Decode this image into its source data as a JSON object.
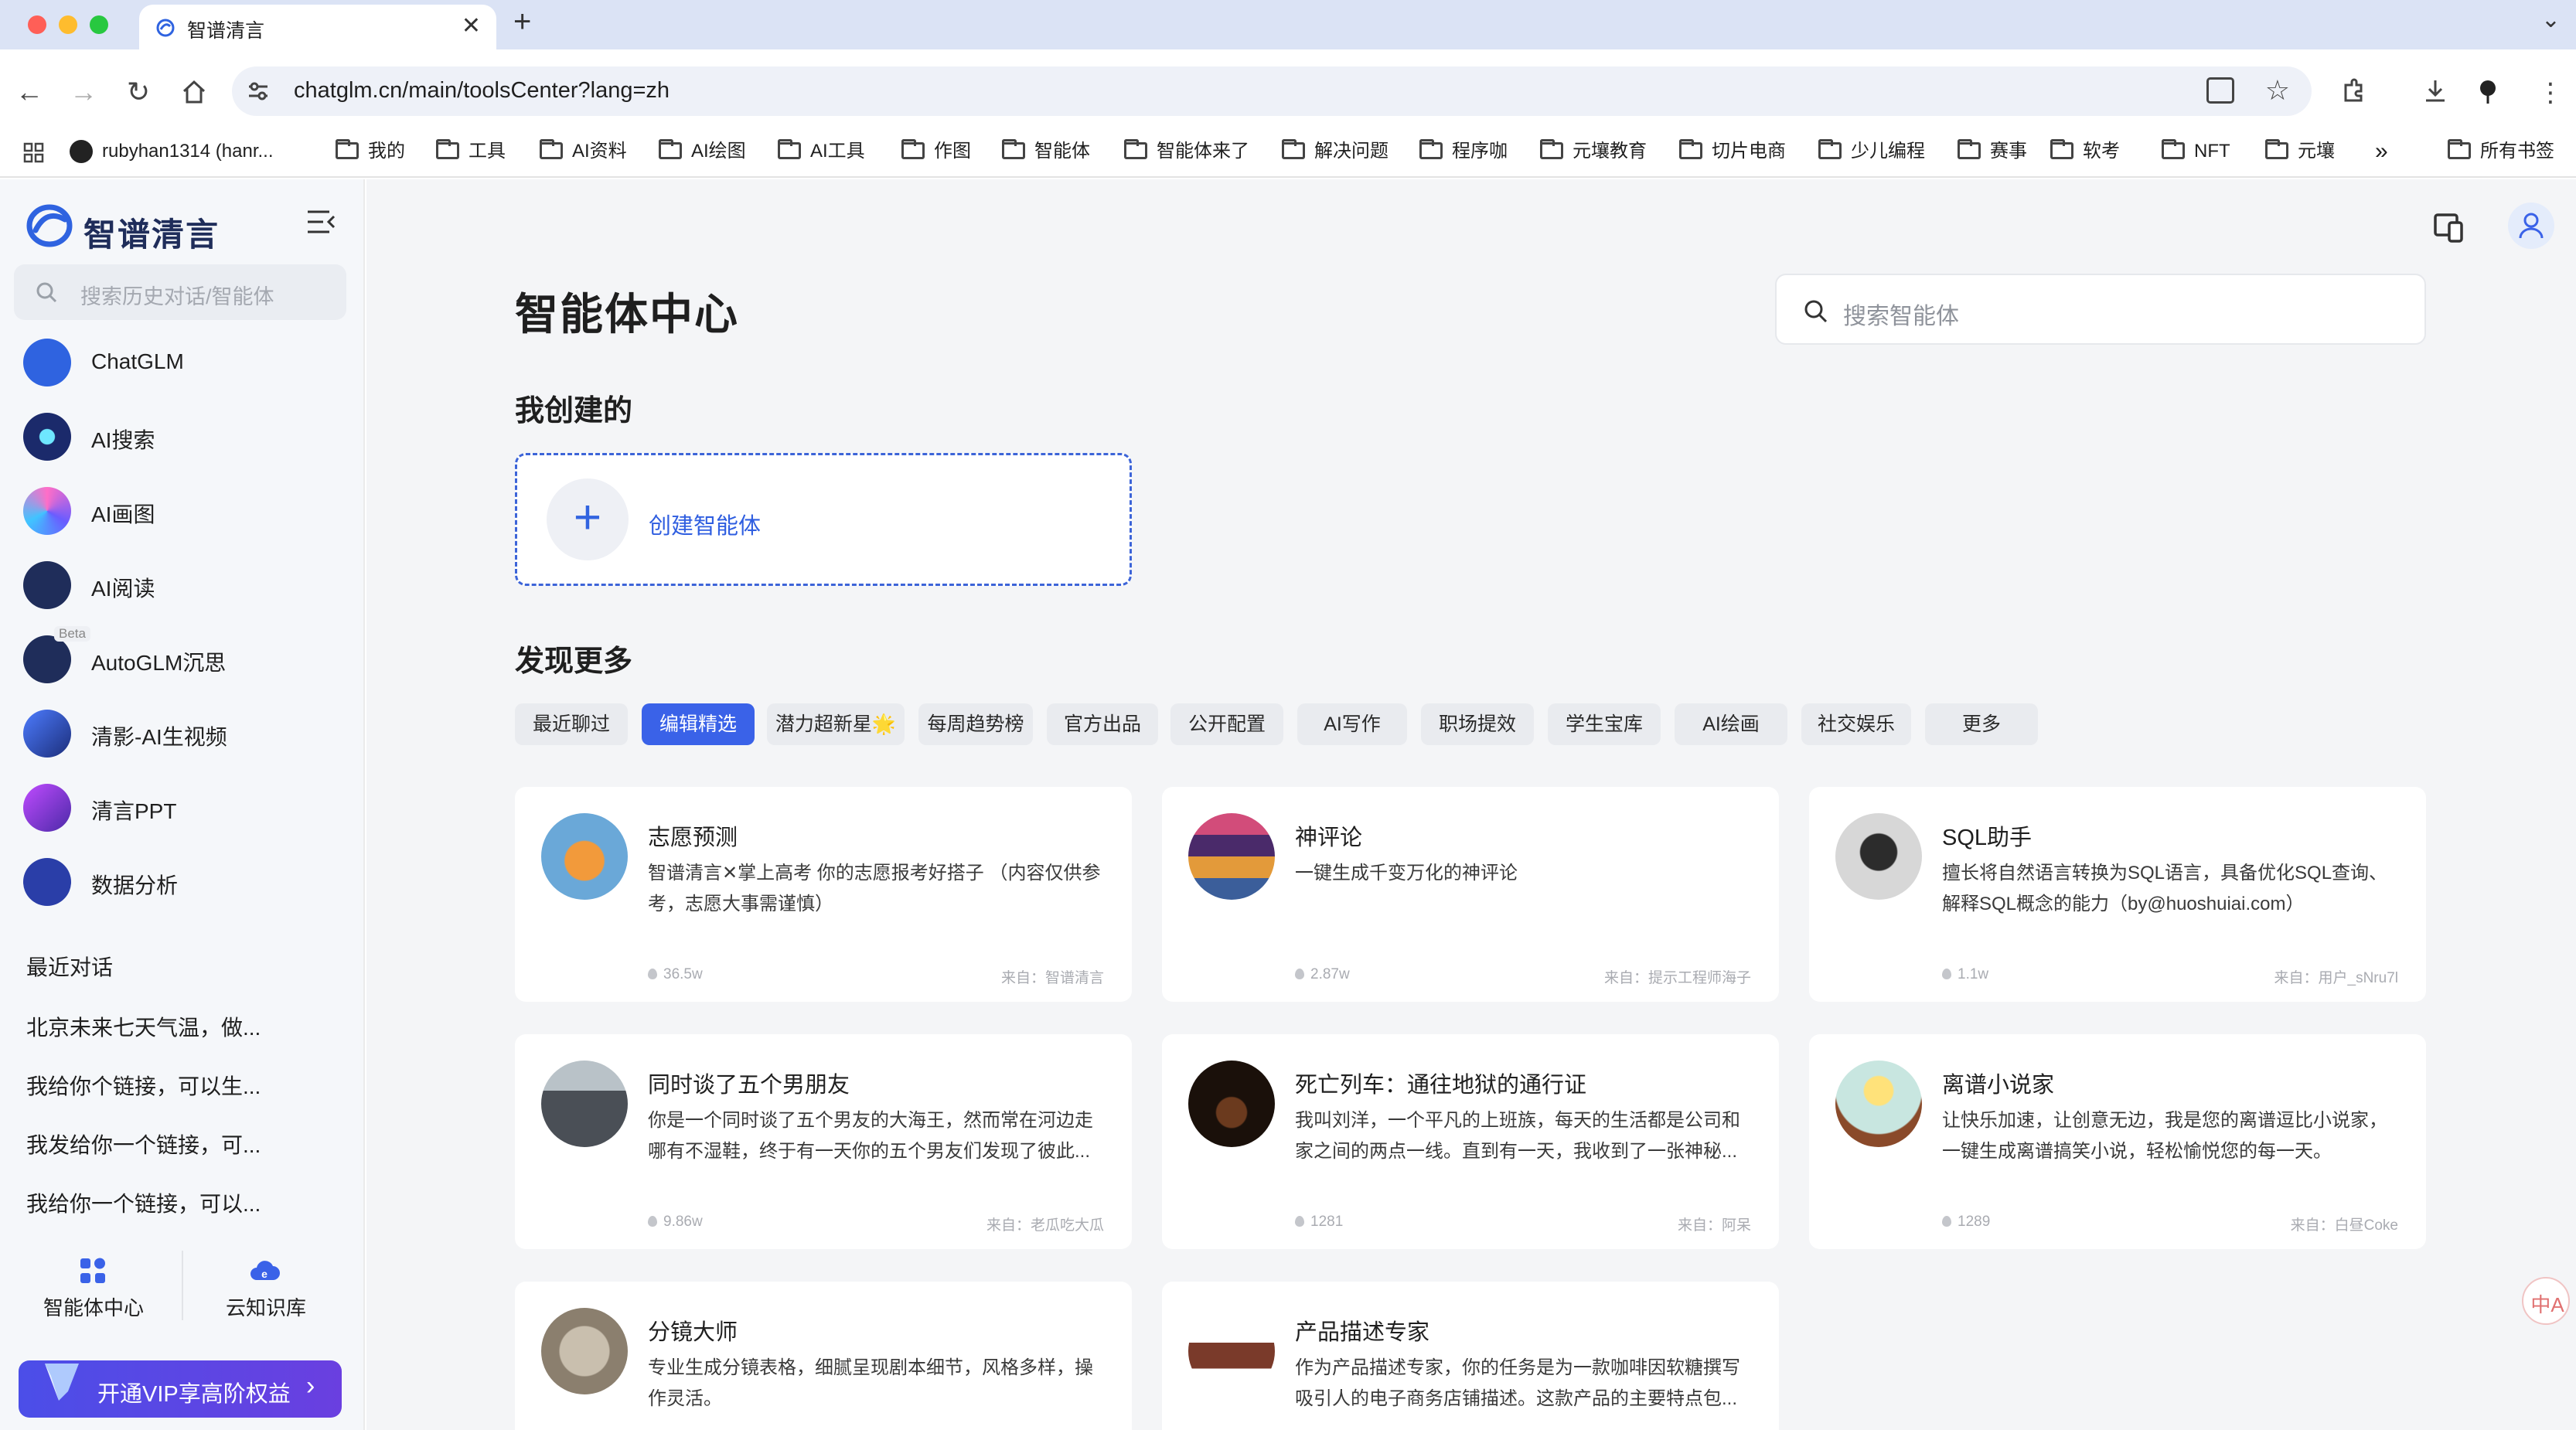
{
  "browser": {
    "tab_title": "智谱清言",
    "url": "chatglm.cn/main/toolsCenter?lang=zh",
    "bookmarks": [
      {
        "label": "rubyhan1314 (hanr..."
      },
      {
        "label": "我的"
      },
      {
        "label": "工具"
      },
      {
        "label": "AI资料"
      },
      {
        "label": "AI绘图"
      },
      {
        "label": "AI工具"
      },
      {
        "label": "作图"
      },
      {
        "label": "智能体"
      },
      {
        "label": "智能体来了"
      },
      {
        "label": "解决问题"
      },
      {
        "label": "程序咖"
      },
      {
        "label": "元壤教育"
      },
      {
        "label": "切片电商"
      },
      {
        "label": "少儿编程"
      },
      {
        "label": "赛事"
      },
      {
        "label": "软考"
      },
      {
        "label": "NFT"
      },
      {
        "label": "元壤"
      }
    ],
    "more_bookmarks": "»",
    "all_bookmarks": "所有书签"
  },
  "sidebar": {
    "logo_text": "智谱清言",
    "search_placeholder": "搜索历史对话/智能体",
    "nav": [
      {
        "label": "ChatGLM",
        "icon": "chatglm-icon"
      },
      {
        "label": "AI搜索",
        "icon": "ai-search-icon"
      },
      {
        "label": "AI画图",
        "icon": "ai-draw-icon"
      },
      {
        "label": "AI阅读",
        "icon": "ai-read-icon"
      },
      {
        "label": "AutoGLM沉思",
        "icon": "autoglm-icon",
        "badge": "Beta"
      },
      {
        "label": "清影-AI生视频",
        "icon": "video-icon"
      },
      {
        "label": "清言PPT",
        "icon": "ppt-icon"
      },
      {
        "label": "数据分析",
        "icon": "data-analysis-icon"
      }
    ],
    "recent_title": "最近对话",
    "recent": [
      "北京未来七天气温，做...",
      "我给你个链接，可以生...",
      "我发给你一个链接，可...",
      "我给你一个链接，可以..."
    ],
    "bottom": [
      {
        "label": "智能体中心",
        "icon": "agent-center-icon"
      },
      {
        "label": "云知识库",
        "icon": "cloud-kb-icon"
      }
    ],
    "vip_label": "开通VIP享高阶权益",
    "vip_arrow": "›"
  },
  "main": {
    "title": "智能体中心",
    "search_placeholder": "搜索智能体",
    "mine_title": "我创建的",
    "create_label": "创建智能体",
    "discover_title": "发现更多",
    "chips": [
      {
        "label": "最近聊过",
        "active": false
      },
      {
        "label": "编辑精选",
        "active": true
      },
      {
        "label": "潜力超新星🌟",
        "active": false
      },
      {
        "label": "每周趋势榜",
        "active": false
      },
      {
        "label": "官方出品",
        "active": false
      },
      {
        "label": "公开配置",
        "active": false
      },
      {
        "label": "AI写作",
        "active": false
      },
      {
        "label": "职场提效",
        "active": false
      },
      {
        "label": "学生宝库",
        "active": false
      },
      {
        "label": "AI绘画",
        "active": false
      },
      {
        "label": "社交娱乐",
        "active": false
      },
      {
        "label": "更多",
        "active": false
      }
    ],
    "cards": [
      {
        "name": "志愿预测",
        "desc": "智谱清言✕掌上高考 你的志愿报考好搭子 （内容仅供参考，志愿大事需谨慎）",
        "stat": "36.5w",
        "from": "来自：智谱清言"
      },
      {
        "name": "神评论",
        "desc": "一键生成千变万化的神评论",
        "stat": "2.87w",
        "from": "来自：提示工程师海子"
      },
      {
        "name": "SQL助手",
        "desc": "擅长将自然语言转换为SQL语言，具备优化SQL查询、解释SQL概念的能力（by@huoshuiai.com）",
        "stat": "1.1w",
        "from": "来自：用户_sNru7l"
      },
      {
        "name": "同时谈了五个男朋友",
        "desc": "你是一个同时谈了五个男友的大海王，然而常在河边走哪有不湿鞋，终于有一天你的五个男友们发现了彼此...",
        "stat": "9.86w",
        "from": "来自：老瓜吃大瓜"
      },
      {
        "name": "死亡列车：通往地狱的通行证",
        "desc": "我叫刘洋，一个平凡的上班族，每天的生活都是公司和家之间的两点一线。直到有一天，我收到了一张神秘...",
        "stat": "1281",
        "from": "来自：阿呆"
      },
      {
        "name": "离谱小说家",
        "desc": "让快乐加速，让创意无边，我是您的离谱逗比小说家，一键生成离谱搞笑小说，轻松愉悦您的每一天。",
        "stat": "1289",
        "from": "来自：白昼Coke"
      },
      {
        "name": "分镜大师",
        "desc": "专业生成分镜表格，细腻呈现剧本细节，风格多样，操作灵活。",
        "stat": "",
        "from": ""
      },
      {
        "name": "产品描述专家",
        "desc": "作为产品描述专家，你的任务是为一款咖啡因软糖撰写吸引人的电子商务店铺描述。这款产品的主要特点包...",
        "stat": "",
        "from": ""
      }
    ]
  },
  "floating": {
    "translate_label": "中A"
  }
}
